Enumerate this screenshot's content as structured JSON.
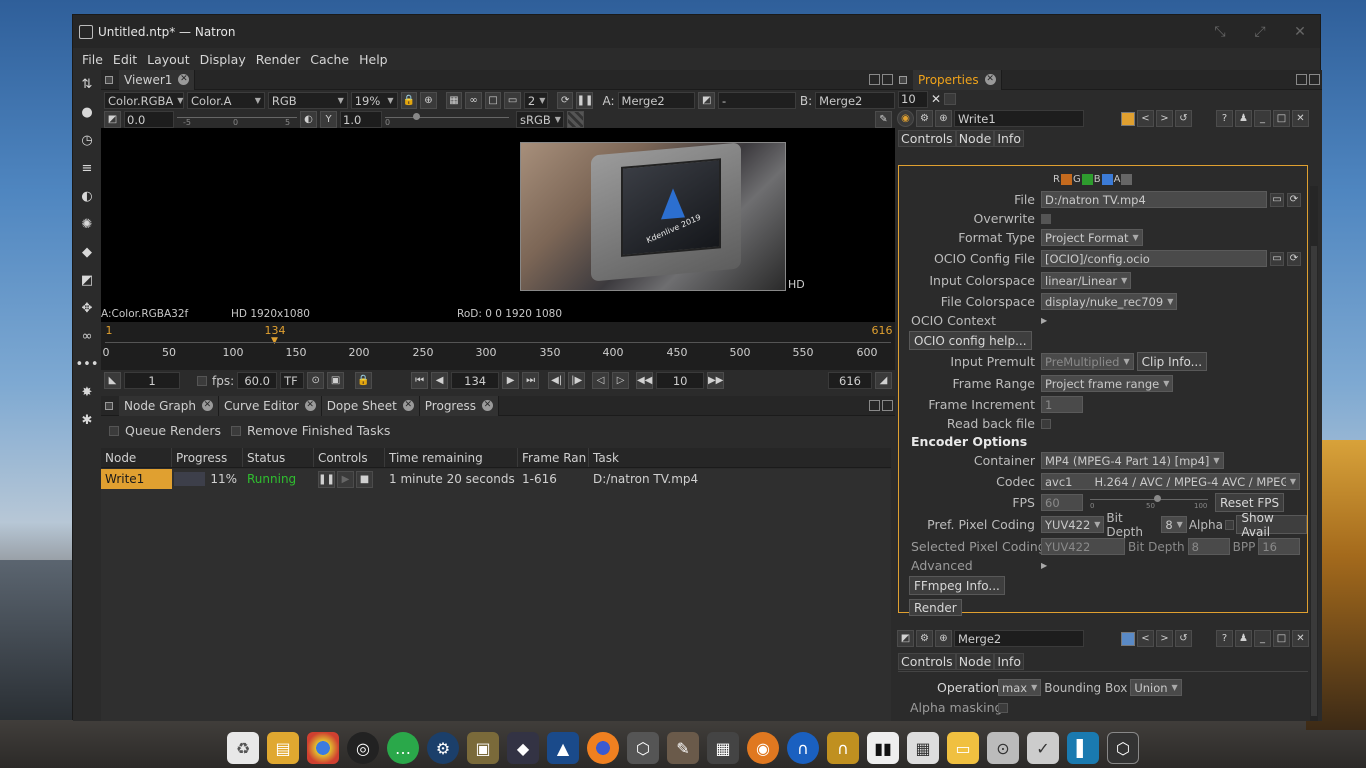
{
  "window": {
    "title": "Untitled.ntp* — Natron"
  },
  "menu": [
    "File",
    "Edit",
    "Layout",
    "Display",
    "Render",
    "Cache",
    "Help"
  ],
  "viewer": {
    "tab": "Viewer1",
    "layer": "Color.RGBA",
    "alpha": "Color.A",
    "channels": "RGB",
    "zoom": "19%",
    "proxy_level": "2",
    "input_a_label": "A:",
    "input_a": "Merge2",
    "input_b_label": "B:",
    "input_b": "Merge2",
    "operator": "-",
    "gain": "0.0",
    "gamma_label": "Y",
    "gamma": "1.0",
    "colorspace": "sRGB",
    "slider_ticks": [
      "-5",
      "0",
      "5",
      "0"
    ],
    "format_label": "HD",
    "info_layer": "A:Color.RGBA32f",
    "info_format": "HD 1920x1080",
    "info_rod": "RoD: 0 0 1920 1080",
    "image_text": "Kdenlive 2019"
  },
  "timeline": {
    "start_marker": "1",
    "current_marker": "134",
    "end_marker": "616",
    "ticks": [
      "0",
      "50",
      "100",
      "150",
      "200",
      "250",
      "300",
      "350",
      "400",
      "450",
      "500",
      "550",
      "600"
    ],
    "first_frame": "1",
    "fps_label": "fps:",
    "fps": "60.0",
    "turbo": "TF",
    "current_frame": "134",
    "step": "10",
    "last_frame": "616"
  },
  "bottom_tabs": [
    "Node Graph",
    "Curve Editor",
    "Dope Sheet",
    "Progress"
  ],
  "progress": {
    "queue_renders": "Queue Renders",
    "remove_finished": "Remove Finished Tasks",
    "columns": [
      "Node",
      "Progress",
      "Status",
      "Controls",
      "Time remaining",
      "Frame Ran",
      "Task"
    ],
    "rows": [
      {
        "node": "Write1",
        "progress": "11%",
        "progress_value": 0.11,
        "status": "Running",
        "time_remaining": "1 minute 20 seconds",
        "frame_range": "1-616",
        "task": "D:/natron TV.mp4"
      }
    ]
  },
  "properties": {
    "tab": "Properties",
    "max_panels": "10",
    "write_node": {
      "name": "Write1",
      "color": "#e0a030",
      "subtabs": [
        "Controls",
        "Node",
        "Info"
      ],
      "channels": [
        "R",
        "G",
        "B",
        "A"
      ],
      "fields": {
        "file_label": "File",
        "file": "D:/natron TV.mp4",
        "overwrite_label": "Overwrite",
        "format_type_label": "Format Type",
        "format_type": "Project Format",
        "ocio_config_label": "OCIO Config File",
        "ocio_config": "[OCIO]/config.ocio",
        "input_cs_label": "Input Colorspace",
        "input_cs": "linear/Linear",
        "file_cs_label": "File Colorspace",
        "file_cs": "display/nuke_rec709",
        "ocio_context_label": "OCIO Context",
        "ocio_help": "OCIO config help...",
        "input_premult_label": "Input Premult",
        "input_premult": "PreMultiplied",
        "clip_info": "Clip Info...",
        "frame_range_label": "Frame Range",
        "frame_range": "Project frame range",
        "frame_increment_label": "Frame Increment",
        "frame_increment": "1",
        "read_back_label": "Read back file",
        "encoder_options": "Encoder Options",
        "container_label": "Container",
        "container": "MP4 (MPEG-4 Part 14) [mp4]",
        "codec_label": "Codec",
        "codec_short": "avc1",
        "codec": "H.264 / AVC / MPEG-4 AVC / MPEG",
        "fps_label": "FPS",
        "fps": "60",
        "fps_ticks": [
          "0",
          "50",
          "100"
        ],
        "reset_fps": "Reset FPS",
        "pref_pixel_label": "Pref. Pixel Coding",
        "pref_pixel": "YUV422",
        "bit_depth_label": "Bit Depth",
        "bit_depth": "8",
        "alpha_label": "Alpha",
        "show_avail": "Show Avail",
        "sel_pixel_label": "Selected Pixel Coding",
        "sel_pixel": "YUV422",
        "sel_bit_depth": "8",
        "bpp_label": "BPP",
        "bpp": "16",
        "advanced_label": "Advanced",
        "ffmpeg_info": "FFmpeg Info...",
        "render": "Render"
      }
    },
    "merge_node": {
      "name": "Merge2",
      "color": "#5a8ac6",
      "subtabs": [
        "Controls",
        "Node",
        "Info"
      ],
      "operation_label": "Operation",
      "operation": "max",
      "bbox_label": "Bounding Box",
      "bbox": "Union",
      "alpha_masking_label": "Alpha masking"
    }
  },
  "dock": [
    "trash-icon",
    "files-icon",
    "chrome-icon",
    "obs-icon",
    "chat-icon",
    "steam-icon",
    "archive-icon",
    "box-icon",
    "inkscape-icon",
    "firefox-icon",
    "package-icon",
    "gimp-icon",
    "film-icon",
    "blender-icon",
    "audio-icon",
    "headphones-icon",
    "piano-icon",
    "calculator-icon",
    "notes-icon",
    "disk-icon",
    "scribus-icon",
    "sidebar-icon",
    "natron-icon"
  ]
}
